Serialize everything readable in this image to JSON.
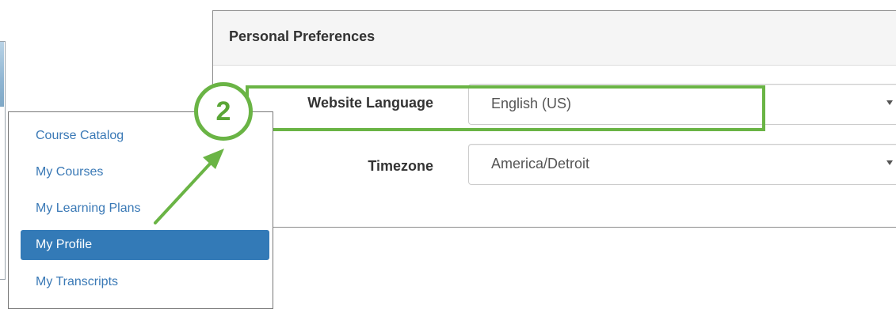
{
  "panel": {
    "title": "Personal Preferences",
    "fields": [
      {
        "label": "Website Language",
        "value": "English (US)"
      },
      {
        "label": "Timezone",
        "value": "America/Detroit"
      }
    ]
  },
  "annotation": {
    "step_number": "2",
    "color": "#6ab445"
  },
  "menu": {
    "items": [
      {
        "label": "Course Catalog",
        "active": false
      },
      {
        "label": "My Courses",
        "active": false
      },
      {
        "label": "My Learning Plans",
        "active": false
      },
      {
        "label": "My Profile",
        "active": true
      },
      {
        "label": "My Transcripts",
        "active": false
      }
    ],
    "active_color": "#337ab7",
    "link_color": "#3a79b6"
  },
  "icons": {
    "select_caret": "caret-down-icon",
    "arrow": "arrow-up-right-icon"
  }
}
